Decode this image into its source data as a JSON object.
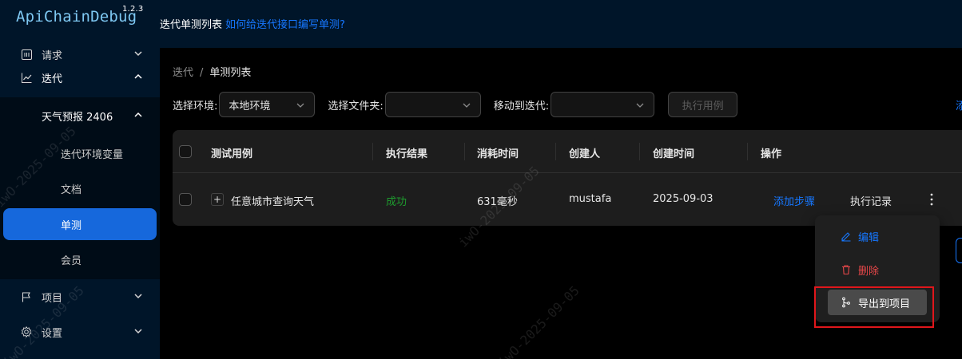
{
  "app": {
    "logo_text": "ApiChainDebug",
    "version": "1.2.3"
  },
  "header": {
    "title": "迭代单测列表",
    "help_link": "如何给迭代接口编写单测?"
  },
  "sidebar": {
    "items": [
      {
        "label": "请求",
        "icon": "request-icon",
        "expanded": false
      },
      {
        "label": "迭代",
        "icon": "line-chart-icon",
        "expanded": true
      },
      {
        "label": "项目",
        "icon": "flag-icon",
        "expanded": false
      },
      {
        "label": "设置",
        "icon": "gear-icon",
        "expanded": false
      }
    ],
    "group": {
      "label": "天气预报 2406",
      "expanded": true
    },
    "sub_items": [
      {
        "label": "迭代环境变量",
        "active": false
      },
      {
        "label": "文档",
        "active": false
      },
      {
        "label": "单测",
        "active": true
      },
      {
        "label": "会员",
        "active": false
      }
    ]
  },
  "breadcrumb": {
    "parent": "迭代",
    "separator": "/",
    "current": "单测列表"
  },
  "filters": {
    "env_label": "选择环境:",
    "env_value": "本地环境",
    "folder_label": "选择文件夹:",
    "folder_value": "",
    "move_label": "移动到迭代:",
    "move_value": "",
    "run_button": "执行用例",
    "edge_link": "添"
  },
  "table": {
    "columns": [
      "测试用例",
      "执行结果",
      "消耗时间",
      "创建人",
      "创建时间",
      "操作"
    ],
    "rows": [
      {
        "name": "任意城市查询天气",
        "result": "成功",
        "duration": "631毫秒",
        "creator": "mustafa",
        "created": "2025-09-03",
        "action_add_steps": "添加步骤",
        "action_history": "执行记录"
      }
    ]
  },
  "dropdown": {
    "edit": "编辑",
    "delete": "删除",
    "export": "导出到项目"
  },
  "watermark": {
    "text_a": "iwO-2025-09-05",
    "text_b": "iwO-2025-09-05",
    "text_c": "iwO-2025-09-05",
    "text_d": "iwO-2025-09-05"
  },
  "colors": {
    "primary": "#1677ff",
    "sidebar_bg": "#001529",
    "active_bg": "#1668dc",
    "success": "#1e9b2e",
    "danger": "#e84749",
    "highlight": "#e0161b"
  }
}
